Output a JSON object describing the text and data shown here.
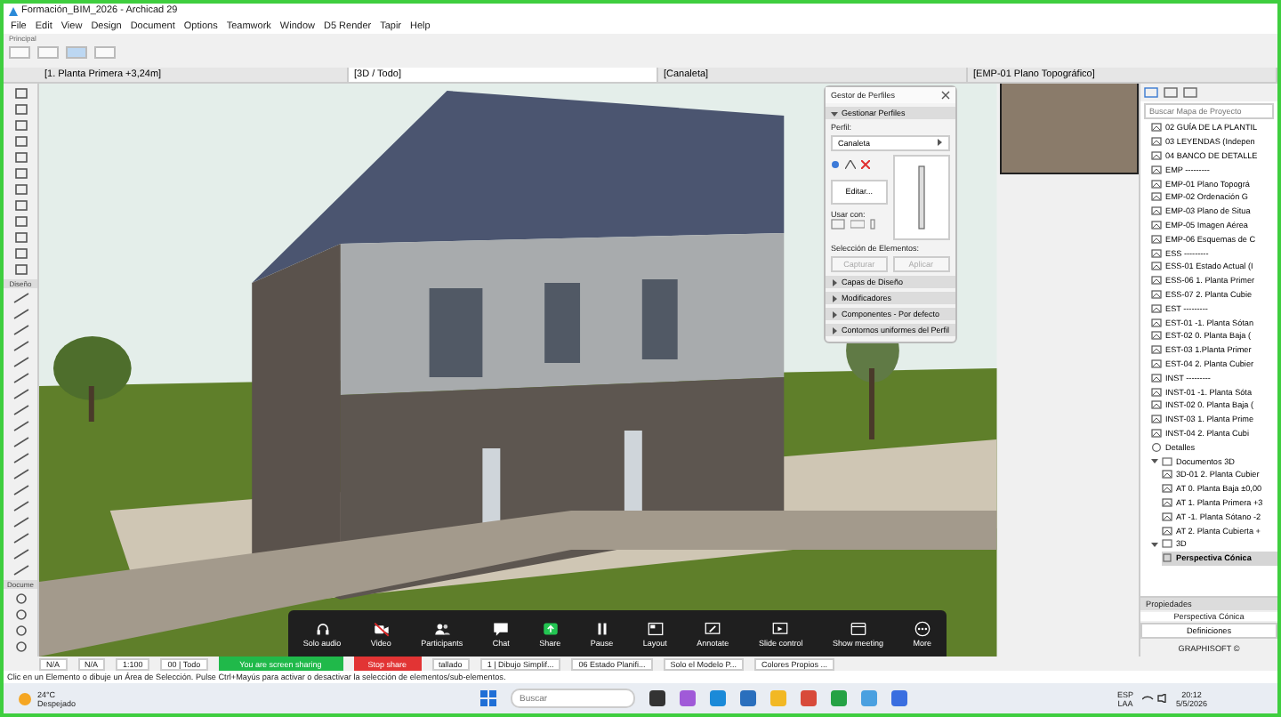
{
  "window": {
    "title": "Formación_BIM_2026 - Archicad 29"
  },
  "menu": [
    "File",
    "Edit",
    "View",
    "Design",
    "Document",
    "Options",
    "Teamwork",
    "Window",
    "D5 Render",
    "Tapir",
    "Help"
  ],
  "toolbar": {
    "label": "Principal"
  },
  "view_tabs": [
    {
      "label": "[1. Planta Primera +3,24m]",
      "selected": false
    },
    {
      "label": "[3D / Todo]",
      "selected": true
    },
    {
      "label": "[Canaleta]",
      "selected": false
    },
    {
      "label": "[EMP-01 Plano Topográfico]",
      "selected": false
    }
  ],
  "toolbox": {
    "sections": [
      "Diseño",
      "Docume"
    ]
  },
  "profile_manager": {
    "title": "Gestor de Perfiles",
    "section": {
      "label": "Gestionar Perfiles",
      "expanded": true
    },
    "profile_label": "Perfil:",
    "profile": "Canaleta",
    "edit_button": "Editar...",
    "use_with_label": "Usar con:",
    "selection_label": "Selección de Elementos:",
    "selection_buttons": [
      {
        "label": "Capturar",
        "disabled": true
      },
      {
        "label": "Aplicar",
        "disabled": true
      }
    ],
    "subsections": [
      {
        "label": "Capas de Diseño",
        "expanded": false
      },
      {
        "label": "Modificadores",
        "expanded": false
      },
      {
        "label": "Componentes - Por defecto",
        "expanded": false
      },
      {
        "label": "Contornos uniformes del Perfil",
        "expanded": false
      }
    ]
  },
  "meeting_toolbar": [
    {
      "label": "Solo audio",
      "kind": "audio"
    },
    {
      "label": "Video",
      "kind": "video"
    },
    {
      "label": "Participants",
      "kind": "participants"
    },
    {
      "label": "Chat",
      "kind": "chat"
    },
    {
      "label": "Share",
      "kind": "share"
    },
    {
      "label": "Pause",
      "kind": "pause"
    },
    {
      "label": "Layout",
      "kind": "layout"
    },
    {
      "label": "Annotate",
      "kind": "annotate"
    },
    {
      "label": "Slide control",
      "kind": "slides"
    },
    {
      "label": "Show meeting",
      "kind": "meeting"
    },
    {
      "label": "More",
      "kind": "more"
    }
  ],
  "navigator": {
    "search_placeholder": "Buscar Mapa de Proyecto",
    "items": [
      {
        "label": "02 GUÍA DE LA PLANTIL",
        "kind": "view",
        "selected": false
      },
      {
        "label": "03 LEYENDAS (Indepen",
        "kind": "view",
        "selected": false
      },
      {
        "label": "04 BANCO DE DETALLE",
        "kind": "view",
        "selected": false
      },
      {
        "label": "EMP ---------",
        "kind": "view",
        "selected": false
      },
      {
        "label": "EMP-01 Plano Topográ",
        "kind": "view",
        "selected": false
      },
      {
        "label": "EMP-02 Ordenación G",
        "kind": "view",
        "selected": false
      },
      {
        "label": "EMP-03 Plano de Situa",
        "kind": "view",
        "selected": false
      },
      {
        "label": "EMP-05 Imagen Aérea",
        "kind": "view",
        "selected": false
      },
      {
        "label": "EMP-06 Esquemas de C",
        "kind": "view",
        "selected": false
      },
      {
        "label": "ESS ---------",
        "kind": "view",
        "selected": false
      },
      {
        "label": "ESS-01 Estado Actual (I",
        "kind": "view",
        "selected": false
      },
      {
        "label": "ESS-06 1. Planta Primer",
        "kind": "view",
        "selected": false
      },
      {
        "label": "ESS-07 2. Planta Cubie",
        "kind": "view",
        "selected": false
      },
      {
        "label": "EST ---------",
        "kind": "view",
        "selected": false
      },
      {
        "label": "EST-01 -1. Planta Sótan",
        "kind": "view",
        "selected": false
      },
      {
        "label": "EST-02 0. Planta Baja (",
        "kind": "view",
        "selected": false
      },
      {
        "label": "EST-03 1.Planta Primer",
        "kind": "view",
        "selected": false
      },
      {
        "label": "EST-04 2. Planta Cubier",
        "kind": "view",
        "selected": false
      },
      {
        "label": "INST ---------",
        "kind": "view",
        "selected": false
      },
      {
        "label": "INST-01 -1. Planta Sóta",
        "kind": "view",
        "selected": false
      },
      {
        "label": "INST-02 0. Planta Baja (",
        "kind": "view",
        "selected": false
      },
      {
        "label": "INST-03 1. Planta Prime",
        "kind": "view",
        "selected": false
      },
      {
        "label": "INST-04 2. Planta Cubi",
        "kind": "view",
        "selected": false
      },
      {
        "label": "Detalles",
        "kind": "details",
        "selected": false
      },
      {
        "label": "Documentos 3D",
        "kind": "folder",
        "selected": false,
        "expanded": true,
        "children": [
          {
            "label": "3D-01 2. Planta Cubier",
            "kind": "view",
            "selected": false
          },
          {
            "label": "AT 0. Planta Baja ±0,00",
            "kind": "view",
            "selected": false
          },
          {
            "label": "AT 1. Planta Primera +3",
            "kind": "view",
            "selected": false
          },
          {
            "label": "AT -1. Planta Sótano -2",
            "kind": "view",
            "selected": false
          },
          {
            "label": "AT 2. Planta Cubierta +",
            "kind": "view",
            "selected": false
          }
        ]
      },
      {
        "label": "3D",
        "kind": "folder",
        "selected": false,
        "expanded": true,
        "children": [
          {
            "label": "Perspectiva Cónica",
            "kind": "camera",
            "selected": true
          }
        ]
      }
    ],
    "properties": {
      "title": "Propiedades",
      "name": "Perspectiva Cónica",
      "definitions": "Definiciones"
    },
    "footer": "GRAPHISOFT ©"
  },
  "view_bar": {
    "left": [
      "N/A",
      "N/A"
    ],
    "scale": "1:100",
    "layers": "00 | Todo",
    "items": [
      "tallado",
      "1 | Dibujo Simplif...",
      "06 Estado Planifi...",
      "Solo el Modelo P...",
      "Colores Propios ..."
    ]
  },
  "share_bar": {
    "message": "You are screen sharing",
    "stop": "Stop share"
  },
  "status_text": "Clic en un Elemento o dibuje un Área de Selección. Pulse Ctrl+Mayús para activar o desactivar la selección de elementos/sub-elementos.",
  "taskbar": {
    "temperature": "24°C",
    "condition": "Despejado",
    "search_placeholder": "Buscar",
    "language": "ESP",
    "layout": "LAA",
    "time": "20:12",
    "date": "5/5/2026"
  }
}
